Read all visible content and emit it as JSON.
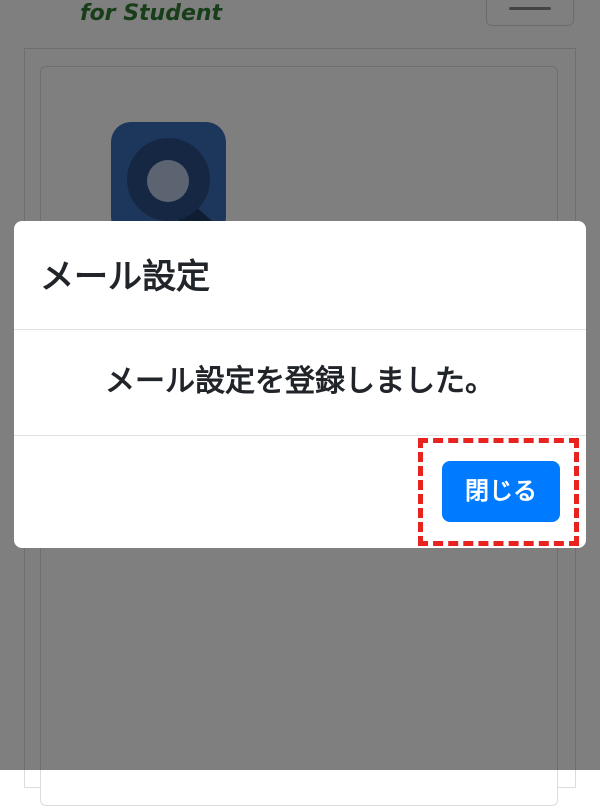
{
  "header": {
    "brand_subtitle": "for Student",
    "menu_toggle_icon": "hamburger-icon"
  },
  "app": {
    "icon": "app-logo-icon",
    "icon_color": "#3b6fb8"
  },
  "modal": {
    "title": "メール設定",
    "message": "メール設定を登録しました。",
    "close_label": "閉じる",
    "close_button_color": "#007bff",
    "highlight_color": "#e8231f"
  }
}
